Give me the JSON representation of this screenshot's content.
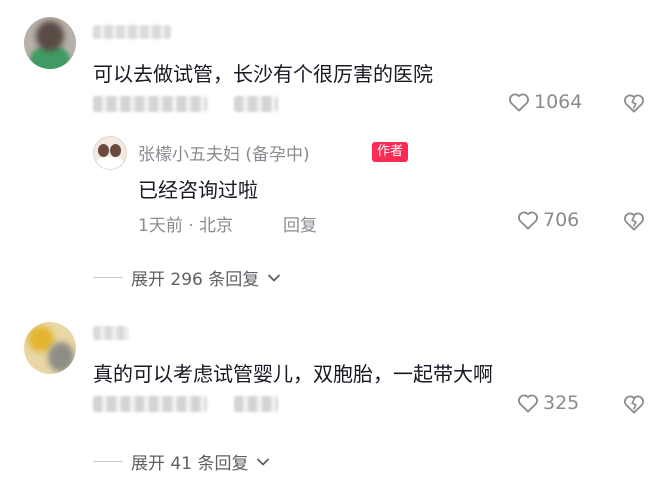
{
  "comments": [
    {
      "text": "可以去做试管，长沙有个很厉害的医院",
      "likes": "1064",
      "reply": {
        "name": "张檬小五夫妇 (备孕中)",
        "tag": "作者",
        "text": "已经咨询过啦",
        "time_location": "1天前 · 北京",
        "reply_label": "回复",
        "likes": "706"
      },
      "expand_label": "展开 296 条回复"
    },
    {
      "text": "真的可以考虑试管婴儿，双胞胎，一起带大啊",
      "likes": "325",
      "expand_label": "展开 41 条回复"
    }
  ],
  "icons": {
    "like": "heart-outline-icon",
    "dislike": "broken-heart-icon",
    "expand": "chevron-down-icon"
  },
  "colors": {
    "text": "#161823",
    "secondary": "#8a8b91",
    "author_tag": "#fe2c55"
  }
}
